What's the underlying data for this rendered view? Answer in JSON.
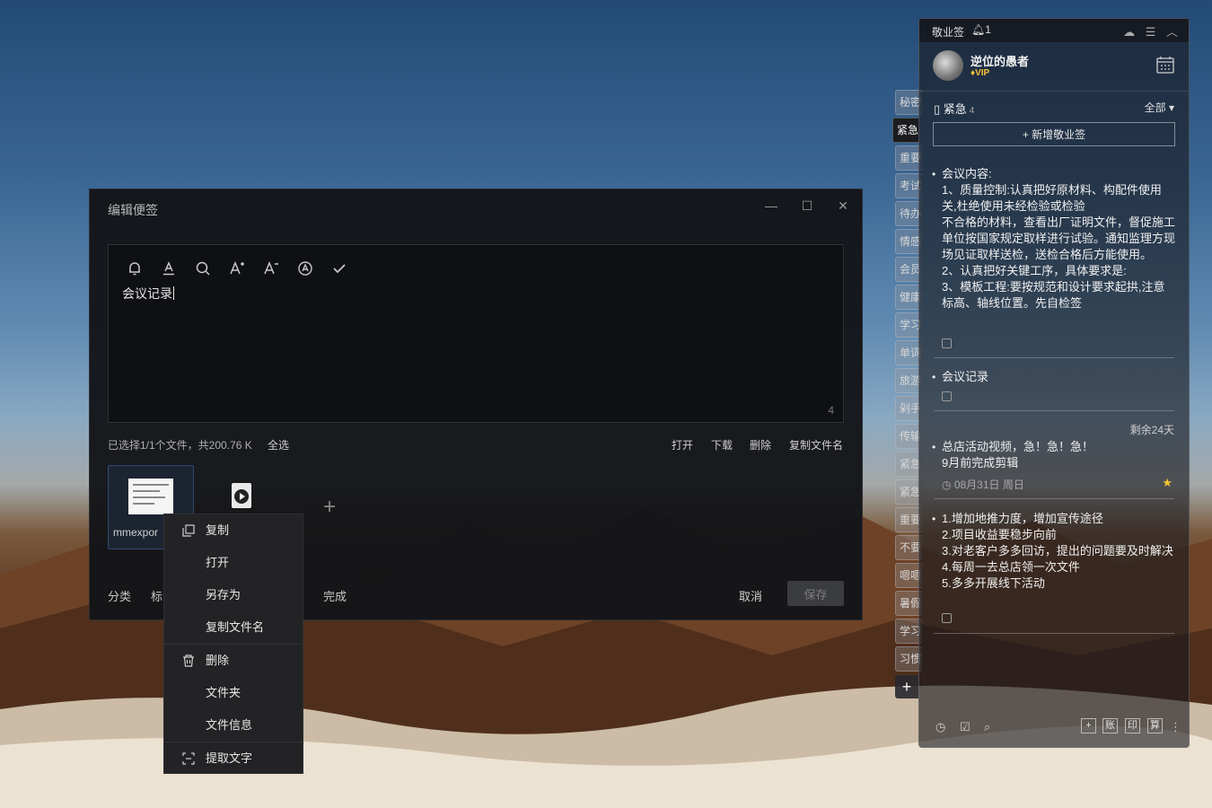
{
  "edit_window": {
    "title": "编辑便签",
    "editor_text": "会议记录",
    "char_count": "4",
    "file_info": "已选择1/1个文件，共200.76 K",
    "select_all": "全选",
    "file_actions": [
      "打开",
      "下载",
      "删除",
      "复制文件名"
    ],
    "file_name": "mmexpor",
    "bottom_left": [
      "分类",
      "标",
      "完成"
    ],
    "cancel": "取消",
    "save": "保存"
  },
  "context_menu": {
    "items": [
      "复制",
      "打开",
      "另存为",
      "复制文件名",
      "删除",
      "文件夹",
      "文件信息",
      "提取文字"
    ]
  },
  "tabs": [
    "秘密",
    "紧急",
    "重要",
    "考试",
    "待办",
    "情感",
    "会员",
    "健康",
    "学习",
    "单词",
    "旅游",
    "剁手",
    "传输",
    "紧急",
    "紧急",
    "重要",
    "不要",
    "嗯嗯",
    "暑假",
    "学习",
    "习惯"
  ],
  "panel": {
    "app_name": "敬业签",
    "notif_count": "1",
    "username": "逆位的愚者",
    "vip": "VIP",
    "category": "紧急",
    "category_count": "4",
    "filter": "全部",
    "new_note": "新增敬业签",
    "notes": [
      {
        "text": "会议内容:\n1、质量控制:认真把好原材料、构配件使用关,杜绝使用未经检验或检验\n不合格的材料，查看出厂证明文件，督促施工单位按国家规定取样进行试验。通知监理方现场见证取样送检，送检合格后方能使用。\n2、认真把好关键工序，具体要求是:\n3、模板工程:要按规范和设计要求起拱,注意标高、轴线位置。先自检签"
      },
      {
        "text": "会议记录"
      },
      {
        "remain": "剩余24天",
        "text": "总店活动视频，急！急！急！\n9月前完成剪辑",
        "date": "08月31日 周日"
      },
      {
        "text": "1.增加地推力度，增加宣传途径\n2.项目收益要稳步向前\n3.对老客户多多回访，提出的问题要及时解决\n4.每周一去总店领一次文件\n5.多多开展线下活动"
      }
    ],
    "footer_boxes": [
      "+",
      "账",
      "印",
      "算"
    ]
  }
}
